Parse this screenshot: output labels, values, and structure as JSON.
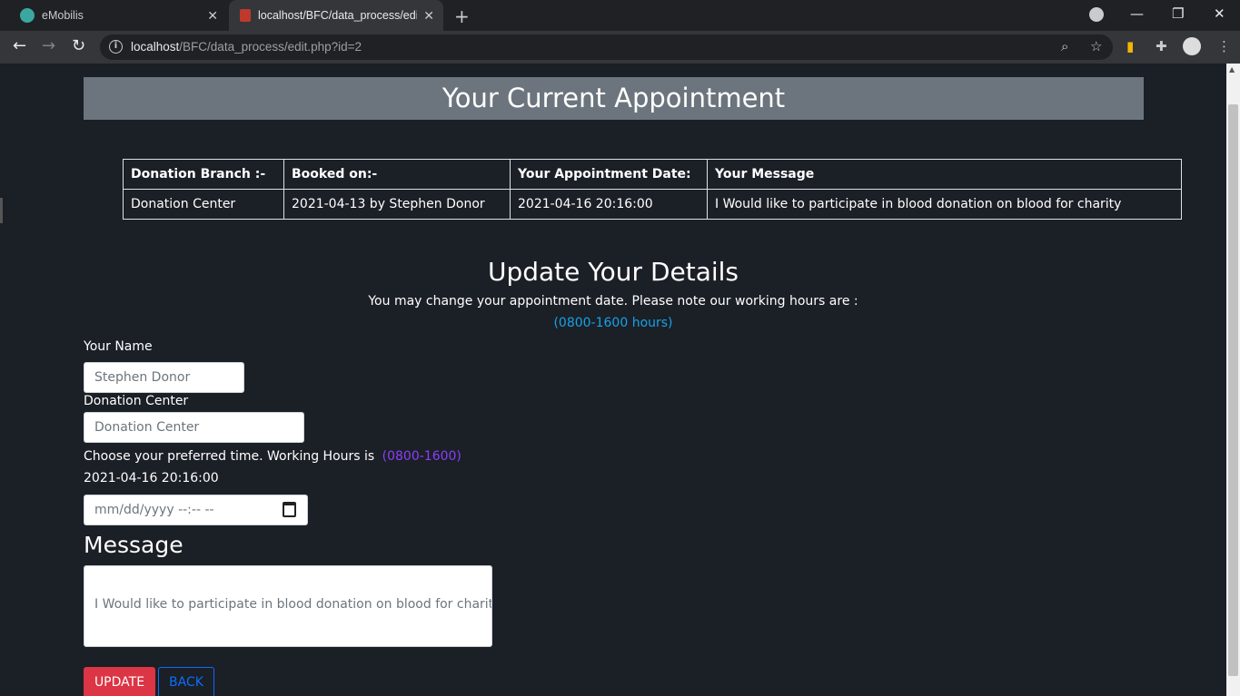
{
  "browser": {
    "tabs": [
      {
        "title": "eMobilis",
        "active": false
      },
      {
        "title": "localhost/BFC/data_process/edit.",
        "active": true
      }
    ],
    "url_host": "localhost",
    "url_path": "/BFC/data_process/edit.php?id=2"
  },
  "page": {
    "banner_title": "Your Current Appointment",
    "table": {
      "headers": [
        "Donation Branch :-",
        "Booked on:-",
        "Your Appointment Date:",
        "Your Message"
      ],
      "row": [
        "Donation Center",
        "2021-04-13 by Stephen Donor",
        "2021-04-16 20:16:00",
        "I Would like to participate in blood donation on blood for charity"
      ]
    },
    "update_title": "Update Your Details",
    "note": "You may change your appointment date. Please note our working hours are :",
    "hours": "(0800-1600 hours)",
    "form": {
      "name_label": "Your Name",
      "name_value": "Stephen Donor",
      "center_label": "Donation Center",
      "center_value": "Donation Center",
      "time_label": "Choose your preferred time. Working Hours is",
      "time_hours": "(0800-1600)",
      "current_time": "2021-04-16 20:16:00",
      "datetime_placeholder": "mm/dd/yyyy --:-- --",
      "message_title": "Message",
      "message_value": "I Would like to participate in blood donation on blood for charity",
      "update_label": "UPDATE",
      "back_label": "BACK"
    }
  },
  "colors": {
    "background": "#1b1f26",
    "banner": "#6c757d",
    "hours_blue": "#17a2e8",
    "hours_purple": "#8a3ffc",
    "update_red": "#dc3545",
    "back_blue": "#0d6efd"
  }
}
